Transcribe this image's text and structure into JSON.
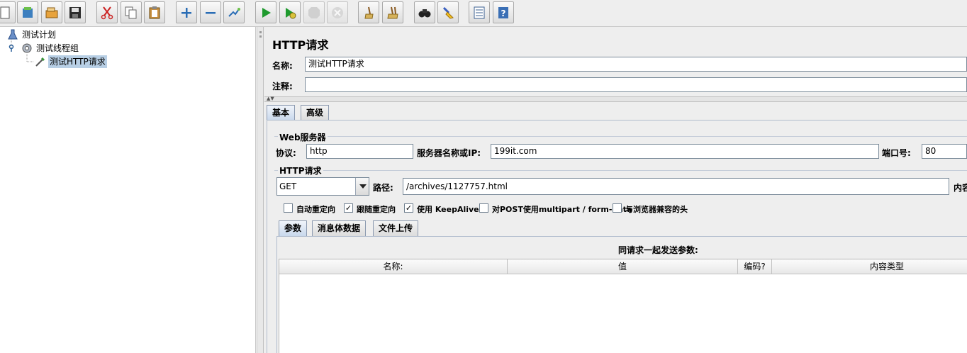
{
  "toolbar": {
    "buttons": [
      {
        "icon": "new-icon"
      },
      {
        "icon": "templates-icon"
      },
      {
        "icon": "open-icon"
      },
      {
        "icon": "save-icon"
      },
      {
        "icon": "cut-icon"
      },
      {
        "icon": "copy-icon"
      },
      {
        "icon": "paste-icon"
      },
      {
        "icon": "expand-icon"
      },
      {
        "icon": "collapse-icon"
      },
      {
        "icon": "toggle-icon"
      },
      {
        "icon": "start-icon"
      },
      {
        "icon": "start-no-pauses-icon"
      },
      {
        "icon": "stop-icon"
      },
      {
        "icon": "shutdown-icon"
      },
      {
        "icon": "clear-icon"
      },
      {
        "icon": "clear-all-icon"
      },
      {
        "icon": "search-icon"
      },
      {
        "icon": "reset-search-icon"
      },
      {
        "icon": "function-helper-icon"
      },
      {
        "icon": "help-icon"
      }
    ]
  },
  "tree": {
    "items": [
      {
        "label": "测试计划",
        "icon": "test-plan-icon"
      },
      {
        "label": "测试线程组",
        "icon": "thread-group-icon"
      },
      {
        "label": "测试HTTP请求",
        "icon": "http-sampler-icon",
        "selected": true
      }
    ]
  },
  "panel": {
    "title": "HTTP请求",
    "name_label": "名称:",
    "name_value": "测试HTTP请求",
    "comment_label": "注释:",
    "comment_value": "",
    "tabs": [
      {
        "label": "基本",
        "active": true
      },
      {
        "label": "高级",
        "active": false
      }
    ],
    "web_server": {
      "group_title": "Web服务器",
      "protocol_label": "协议:",
      "protocol_value": "http",
      "server_label": "服务器名称或IP:",
      "server_value": "199it.com",
      "port_label": "端口号:",
      "port_value": "80"
    },
    "http_request": {
      "group_title": "HTTP请求",
      "method": "GET",
      "path_label": "路径:",
      "path_value": "/archives/1127757.html",
      "content_label": "内容"
    },
    "checkboxes": [
      {
        "label": "自动重定向",
        "checked": false
      },
      {
        "label": "跟随重定向",
        "checked": true
      },
      {
        "label": "使用 KeepAlive",
        "checked": true
      },
      {
        "label": "对POST使用multipart / form-data",
        "checked": false
      },
      {
        "label": "与浏览器兼容的头",
        "checked": false
      }
    ],
    "sub_tabs": [
      {
        "label": "参数",
        "active": true
      },
      {
        "label": "消息体数据",
        "active": false
      },
      {
        "label": "文件上传",
        "active": false
      }
    ],
    "params_caption": "同请求一起发送参数:",
    "columns": [
      "名称:",
      "值",
      "编码?",
      "内容类型"
    ]
  },
  "colors": {
    "selection": "#b8cfe5",
    "background": "#eeeeee",
    "tab_active": "#c8d8ec"
  }
}
